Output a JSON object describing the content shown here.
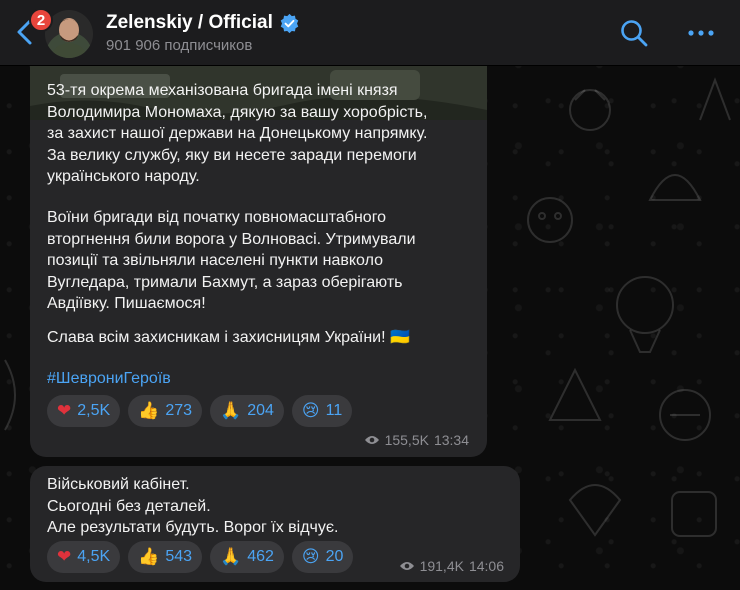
{
  "header": {
    "unread_count": "2",
    "channel_name": "Zelenskiy / Official",
    "subscribers": "901 906 подписчиков"
  },
  "messages": [
    {
      "paragraphs": [
        "53-тя окрема механізована бригада імені князя\nВолодимира Мономаха, дякую за вашу хоробрість,\nза захист нашої держави на Донецькому напрямку.\nЗа велику службу, яку ви несете заради перемоги\nукраїнського народу.",
        "Воїни бригади від початку повномасштабного\nвторгнення били ворога у Волновасі. Утримували\nпозиції та звільняли населені пункти навколо\nВугледара, тримали Бахмут, а зараз оберігають\nАвдіївку. Пишаємося!",
        "Слава всім захисникам і захисницям України! 🇺🇦"
      ],
      "hashtag": "#ШеврониГероїв",
      "reactions": [
        {
          "emoji": "❤",
          "count": "2,5K"
        },
        {
          "emoji": "👍",
          "count": "273"
        },
        {
          "emoji": "🙏",
          "count": "204"
        },
        {
          "emoji": "😢",
          "count": "11"
        }
      ],
      "views": "155,5K",
      "time": "13:34"
    },
    {
      "text": "Військовий кабінет.\nСьогодні без деталей.\nАле результати будуть. Ворог їх відчує.",
      "reactions": [
        {
          "emoji": "❤",
          "count": "4,5K"
        },
        {
          "emoji": "👍",
          "count": "543"
        },
        {
          "emoji": "🙏",
          "count": "462"
        },
        {
          "emoji": "😢",
          "count": "20"
        }
      ],
      "views": "191,4K",
      "time": "14:06"
    }
  ],
  "colors": {
    "accent": "#4ba4f4",
    "bubble": "#262628",
    "header": "#1c1c1e",
    "badge": "#e8453c",
    "heart": "#e0323c"
  }
}
